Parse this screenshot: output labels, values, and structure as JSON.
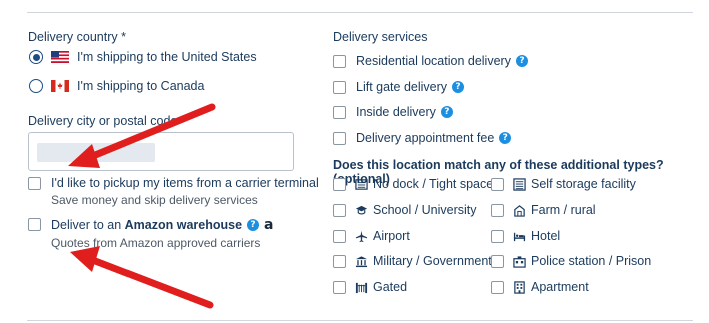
{
  "left": {
    "country_title": "Delivery country *",
    "radio_us": "I'm shipping to the United States",
    "radio_ca": "I'm shipping to Canada",
    "city_title": "Delivery city or postal code *",
    "pickup_label": "I'd like to pickup my items from a carrier terminal",
    "pickup_sub": "Save money and skip delivery services",
    "amazon_prefix": "Deliver to an ",
    "amazon_bold": "Amazon warehouse",
    "amazon_a": "a",
    "amazon_sub": "Quotes from Amazon approved carriers"
  },
  "services": {
    "title": "Delivery services",
    "items": [
      "Residential location delivery",
      "Lift gate delivery",
      "Inside delivery",
      "Delivery appointment fee"
    ]
  },
  "types": {
    "title": "Does this location match any of these additional types? (optional)",
    "left_col": [
      "No dock / Tight space",
      "School / University",
      "Airport",
      "Military / Government",
      "Gated"
    ],
    "right_col": [
      "Self storage facility",
      "Farm / rural",
      "Hotel",
      "Police station / Prison",
      "Apartment"
    ]
  },
  "icons": {
    "help": "?",
    "left_col": [
      "truck-dock-icon",
      "graduation-cap-icon",
      "airplane-icon",
      "government-building-icon",
      "gate-icon"
    ],
    "right_col": [
      "storage-icon",
      "farm-icon",
      "hotel-bed-icon",
      "police-icon",
      "apartment-icon"
    ]
  },
  "colors": {
    "text": "#1b3a5c",
    "accent": "#1b4d86",
    "help": "#1d8fe0",
    "annotation_arrow": "#e01e1e"
  }
}
